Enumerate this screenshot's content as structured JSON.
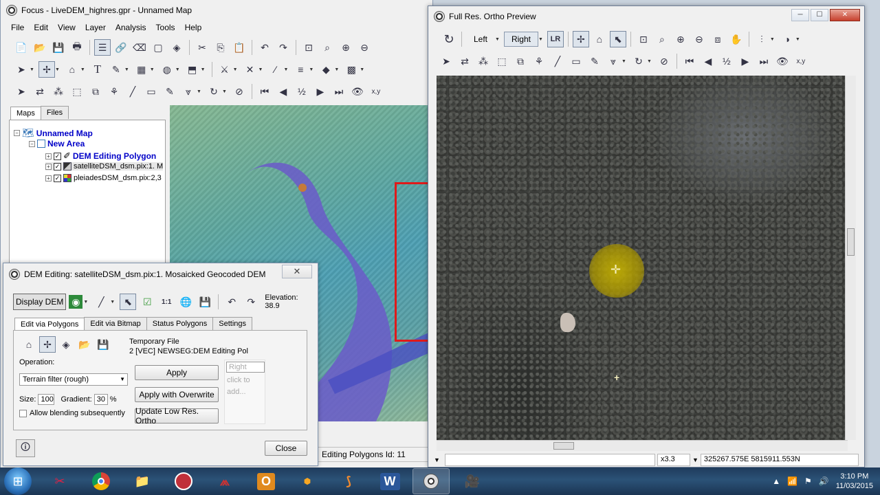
{
  "main_window": {
    "title": "Focus - LiveDEM_highres.gpr - Unnamed Map",
    "menu": [
      "File",
      "Edit",
      "View",
      "Layer",
      "Analysis",
      "Tools",
      "Help"
    ],
    "panel_tabs": [
      "Maps",
      "Files"
    ],
    "tree": {
      "map": "Unnamed Map",
      "area": "New Area",
      "layers": [
        "DEM Editing Polygon",
        "satelliteDSM_dsm.pix:1. M",
        "pleiadesDSM_dsm.pix:2,3"
      ]
    },
    "status": "Editing Polygons  Id: 11"
  },
  "ortho_window": {
    "title": "Full Res. Ortho Preview",
    "left_label": "Left",
    "right_label": "Right",
    "half_label": "½",
    "xy_label": "x,y",
    "zoom": "x3.3",
    "coords": "325267.575E 5815911.553N"
  },
  "dem_dialog": {
    "title": "DEM Editing: satelliteDSM_dsm.pix:1. Mosaicked Geocoded DEM",
    "display_dem": "Display DEM",
    "elevation_label": "Elevation:",
    "elevation_value": "38.9",
    "tabs": [
      "Edit via Polygons",
      "Edit via Bitmap",
      "Status Polygons",
      "Settings"
    ],
    "temp_file_label": "Temporary File",
    "temp_file_value": "2 [VEC] NEWSEG:DEM Editing Pol",
    "operation_label": "Operation:",
    "operation_value": "Terrain filter (rough)",
    "size_label": "Size:",
    "size_value": "100",
    "gradient_label": "Gradient:",
    "gradient_value": "30",
    "percent": "%",
    "allow_blending": "Allow blending subsequently",
    "apply": "Apply",
    "apply_overwrite": "Apply with Overwrite",
    "update_ortho": "Update Low Res. Ortho",
    "right_placeholder": "Right",
    "hint": [
      "click to",
      "add..."
    ],
    "close": "Close"
  },
  "taskbar": {
    "time": "3:10 PM",
    "date": "11/03/2015",
    "word_label": "W",
    "outlook_label": "O"
  },
  "colors": {
    "selection_red": "#e01a1a",
    "tree_blue": "#0000c8",
    "taskbar": "#1f3b5c",
    "cursor_yellow": "#c8b400"
  }
}
